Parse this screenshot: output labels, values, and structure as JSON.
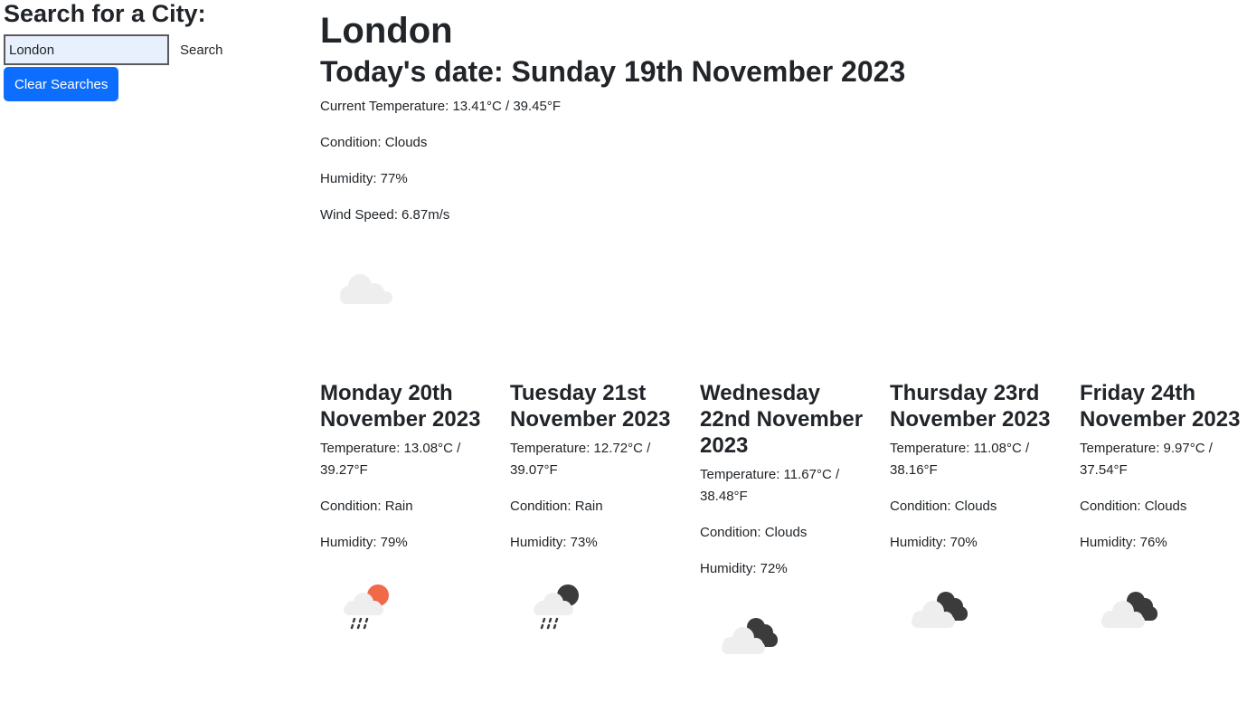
{
  "sidebar": {
    "heading": "Search for a City:",
    "search_value": "London",
    "search_label": "Search",
    "clear_label": "Clear Searches"
  },
  "current": {
    "city": "London",
    "date": "Today's date: Sunday 19th November 2023",
    "temperature": "Current Temperature: 13.41°C / 39.45°F",
    "condition": "Condition: Clouds",
    "humidity": "Humidity: 77%",
    "wind": "Wind Speed: 6.87m/s",
    "icon": "clouds-icon"
  },
  "forecast": [
    {
      "date": "Monday 20th November 2023",
      "temperature": "Temperature: 13.08°C / 39.27°F",
      "condition": "Condition: Rain",
      "humidity": "Humidity: 79%",
      "icon": "rain-sun-icon"
    },
    {
      "date": "Tuesday 21st November 2023",
      "temperature": "Temperature: 12.72°C / 39.07°F",
      "condition": "Condition: Rain",
      "humidity": "Humidity: 73%",
      "icon": "rain-moon-icon"
    },
    {
      "date": "Wednesday 22nd November 2023",
      "temperature": "Temperature: 11.67°C / 38.48°F",
      "condition": "Condition: Clouds",
      "humidity": "Humidity: 72%",
      "icon": "dark-clouds-icon"
    },
    {
      "date": "Thursday 23rd November 2023",
      "temperature": "Temperature: 11.08°C / 38.16°F",
      "condition": "Condition: Clouds",
      "humidity": "Humidity: 70%",
      "icon": "dark-clouds-icon"
    },
    {
      "date": "Friday 24th November 2023",
      "temperature": "Temperature: 9.97°C / 37.54°F",
      "condition": "Condition: Clouds",
      "humidity": "Humidity: 76%",
      "icon": "dark-clouds-icon"
    }
  ],
  "colors": {
    "accent": "#0d6efd",
    "input_bg": "#e8f0fe",
    "sun": "#f06a4a",
    "dark_cloud": "#3b3b3b",
    "light_cloud": "#eeeeee"
  }
}
